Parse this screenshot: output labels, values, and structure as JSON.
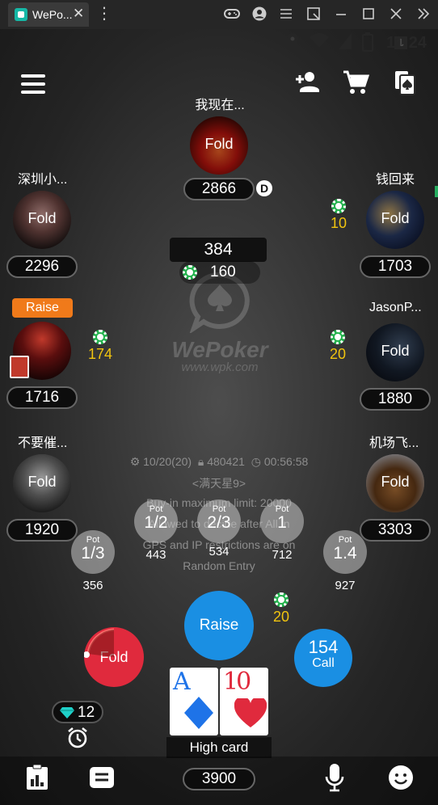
{
  "window": {
    "tab_title": "WePo...",
    "tab_close": "✕"
  },
  "status": {
    "time": "11:24"
  },
  "brand": {
    "name": "WePoker",
    "url": "www.wpk.com"
  },
  "players": [
    {
      "name": "我现在...",
      "stack": "2866",
      "status": "Fold",
      "art": "a1"
    },
    {
      "name": "深圳小...",
      "stack": "2296",
      "status": "Fold",
      "art": "a2"
    },
    {
      "name": "钱回来",
      "stack": "1703",
      "status": "Fold",
      "art": "a3"
    },
    {
      "name": "",
      "stack": "1716",
      "status": "",
      "art": "a4"
    },
    {
      "name": "JasonP...",
      "stack": "1880",
      "status": "Fold",
      "art": "a5"
    },
    {
      "name": "不要催...",
      "stack": "1920",
      "status": "Fold",
      "art": "a6"
    },
    {
      "name": "机场飞...",
      "stack": "3303",
      "status": "Fold",
      "art": "a7"
    }
  ],
  "raise_badge": "Raise",
  "dealer_label": "D",
  "bets": {
    "right_top": "10",
    "left_mid": "174",
    "right_mid": "20",
    "hero": "20"
  },
  "pot": {
    "total": "384",
    "sub": "160"
  },
  "table_info": {
    "blinds": "10/20(20)",
    "room_id": "480421",
    "timer": "00:56:58",
    "room_name": "<满天星9>",
    "line1": "Buy-in maximum limit: 20000",
    "line2": "Allowed to decide after All in",
    "line3": "GPS and IP restrictions are on",
    "line4": "Random Entry"
  },
  "pot_buttons": [
    {
      "label": "Pot",
      "value": "1/3",
      "amount": "356"
    },
    {
      "label": "Pot",
      "value": "1/2",
      "amount": "443"
    },
    {
      "label": "Pot",
      "value": "2/3",
      "amount": "534"
    },
    {
      "label": "Pot",
      "value": "1",
      "amount": "712"
    },
    {
      "label": "Pot",
      "value": "1.4",
      "amount": "927"
    }
  ],
  "actions": {
    "fold": "Fold",
    "raise": "Raise",
    "call_amount": "154",
    "call": "Call"
  },
  "hand": {
    "cards": [
      {
        "rank": "A",
        "suit": "diamond"
      },
      {
        "rank": "10",
        "suit": "heart"
      }
    ],
    "label": "High card"
  },
  "diamonds": "12",
  "my_stack": "3900",
  "colors": {
    "raise": "#1a8fe3",
    "fold": "#e02a3d",
    "bet": "#f1c40f",
    "chip": "#22b14c",
    "badge": "#f07a1a"
  }
}
